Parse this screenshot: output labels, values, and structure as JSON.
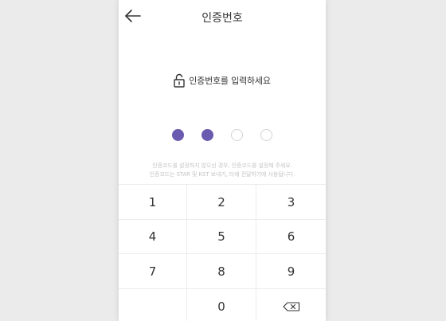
{
  "header": {
    "title": "인증번호"
  },
  "prompt": {
    "text": "인증번호를 입력하세요"
  },
  "pin": {
    "length": 4,
    "entered": 2
  },
  "notice": {
    "line1": "인증코드를 설정하지 않으신 경우, 인증코드를 설정해 주세요.",
    "line2": "인증코드는 STAR 및 KST 보내기, 타에 전달하기에 사용됩니다."
  },
  "keypad": {
    "keys": [
      "1",
      "2",
      "3",
      "4",
      "5",
      "6",
      "7",
      "8",
      "9",
      "",
      "0",
      "backspace"
    ]
  },
  "colors": {
    "accent": "#6a5ab0",
    "empty_dot_border": "#d2d2d2",
    "background": "#ebebeb"
  },
  "icons": {
    "back": "arrow-left-icon",
    "lock": "unlock-icon",
    "delete": "backspace-icon"
  }
}
